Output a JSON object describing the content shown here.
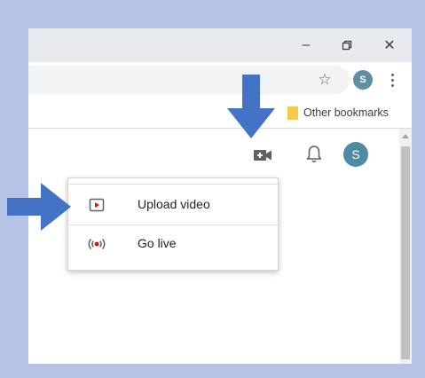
{
  "window_controls": {
    "minimize": "–",
    "restore": "⧉",
    "close": "✕"
  },
  "toolbar": {
    "profile_initial": "S"
  },
  "bookmarks_bar": {
    "other_bookmarks_label": "Other bookmarks"
  },
  "youtube_header": {
    "avatar_initial": "S"
  },
  "create_menu": {
    "items": [
      {
        "label": "Upload video",
        "icon": "upload-video-icon"
      },
      {
        "label": "Go live",
        "icon": "go-live-icon"
      }
    ]
  },
  "colors": {
    "frame": "#b5c4e6",
    "arrow": "#4472c4",
    "accent_red": "#ff0000",
    "avatar": "#4f8aa3"
  },
  "annotations": [
    "arrow pointing to create-video icon",
    "arrow pointing to Upload video"
  ]
}
